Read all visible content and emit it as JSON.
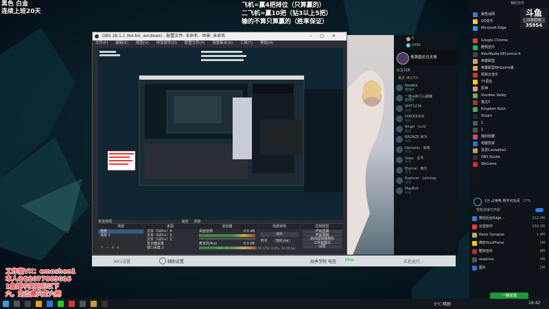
{
  "overlay": {
    "top_left": [
      "黑色 白金",
      "连续上班20天"
    ],
    "top_center": [
      "飞机=赢4把排位（只算赢的）",
      "二飞机=赢10把（钻3以上5把）",
      "输的不算只算赢的（胜率保证）"
    ],
    "bottom_left": [
      "工作室VX：emoshen1",
      "本人QQ2077863016",
      "1鱼翅中奖钻石以下",
      "六，定位赛只打六把"
    ]
  },
  "obs": {
    "title": "OBS 28.1.1 (64-bit, windows) - 配置文件: 未命名 - 场景: 未命名",
    "menu": [
      "文件(F)",
      "编辑(E)",
      "视图(V)",
      "停靠部件(D)",
      "配置文件(P)",
      "场景集合(S)",
      "工具(T)",
      "帮助(H)"
    ],
    "not_selected": "未选择源",
    "properties": "属性",
    "filters": "滤镜",
    "docks": {
      "scenes_header": "场景",
      "sources_header": "来源",
      "mixer_header": "混音器",
      "transitions_header": "场景转场",
      "controls_header": "控制按钮"
    },
    "scenes": [
      "场景",
      "场景 2"
    ],
    "sources": [
      "文本（GDI+）4",
      "文本（GDI+）3",
      "文本（GDI+）2",
      "显示器采集",
      "窗口采集 2"
    ],
    "mixer": [
      {
        "name": "桌面音频",
        "level": "0.0 dB"
      },
      {
        "name": "麦克风/Aux",
        "level": "0.0 dB"
      }
    ],
    "transition": {
      "type": "淡出",
      "duration_label": "时长",
      "duration": "300 ms"
    },
    "controls": [
      "开始直播",
      "开始录制",
      "启动虚拟摄像机",
      "工作室模式",
      "设置",
      "退出"
    ],
    "status": "LIVE: 00:00:00   REC: 00:00:00   CPU: 0.6%, 30.00 fps"
  },
  "client": {
    "currency_1": "0",
    "currency_2": "349K",
    "username": "青铜盖伦日天哥",
    "search": "好友列表",
    "group": "最近 (8/171)",
    "friends": [
      {
        "name": "Newbie",
        "status": "游戏中"
      },
      {
        "name": "一枝从醉几山晨曦",
        "status": "游戏中"
      },
      {
        "name": "SHIT1234",
        "status": "离线"
      },
      {
        "name": "DINODDDD",
        "status": "离线"
      },
      {
        "name": "Angel · lvcI2",
        "status": "离线"
      },
      {
        "name": "BRONZE BOY",
        "status": "离线"
      },
      {
        "name": "Demonic · 如电",
        "status": "离线"
      },
      {
        "name": "Dees · 尼号",
        "status": "离线"
      },
      {
        "name": "Eternal · 雨乐",
        "status": "离线"
      },
      {
        "name": "Explorer · Lotrolay",
        "status": "离线"
      },
      {
        "name": "MapRoll",
        "status": "离线"
      }
    ],
    "tab_tactics": "战争学院 电信",
    "tab_status": "10ms",
    "action": "正在运行..."
  },
  "bottom_bar": {
    "left_label": "AR1设置",
    "settings": "辅助设置"
  },
  "right_panel": {
    "header": "我的文件",
    "apps": [
      "暴雪战网",
      "QQ音乐",
      "Microsoft Edge",
      "Google Chrome",
      "酷我音乐",
      "AVerMedia RECentral 4",
      "英雄联盟",
      "英雄联盟WeGame版",
      "网易云音乐",
      "YY语音",
      "原神",
      "Stardew Valley",
      "鬼泣5",
      "Kingdom Rush",
      "Steam",
      "1",
      "1",
      "我的收藏",
      "电脑管家",
      "喜爱Cantabile2",
      "OBS Studio",
      "WeGame"
    ],
    "live_logo": "斗鱼",
    "live_tag": "斗鱼直播",
    "live_count": "35954",
    "power_status": "1分 占用电 软件可关闭",
    "power_pct": "17%",
    "tip": "智能加速已开启",
    "procs": [
      {
        "name": "微信后台Edge…",
        "size": "212.3M"
      },
      {
        "name": "云雷软件",
        "size": "130.1M"
      },
      {
        "name": "Razer Synapse",
        "size": "1.4M"
      },
      {
        "name": "微软YourPhone",
        "size": "1M"
      },
      {
        "name": "酷狗音乐",
        "size": "4M"
      },
      {
        "name": "onedrive",
        "size": "1M"
      },
      {
        "name": "图片",
        "size": "1M"
      }
    ],
    "clean_button": "一键加速"
  },
  "taskbar": {
    "weather": "3°C 晴朗",
    "time": "16:42"
  }
}
